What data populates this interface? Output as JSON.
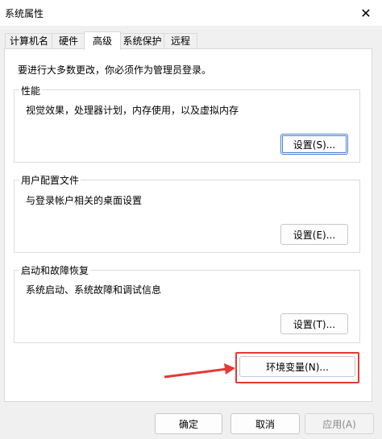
{
  "window": {
    "title": "系统属性",
    "close_icon": "close-icon"
  },
  "tabs": [
    {
      "label": "计算机名",
      "active": false
    },
    {
      "label": "硬件",
      "active": false
    },
    {
      "label": "高级",
      "active": true
    },
    {
      "label": "系统保护",
      "active": false
    },
    {
      "label": "远程",
      "active": false
    }
  ],
  "main": {
    "intro": "要进行大多数更改，你必须作为管理员登录。",
    "performance": {
      "title": "性能",
      "description": "视觉效果，处理器计划，内存使用，以及虚拟内存",
      "button": "设置(S)..."
    },
    "user_profiles": {
      "title": "用户配置文件",
      "description": "与登录帐户相关的桌面设置",
      "button": "设置(E)..."
    },
    "startup_recovery": {
      "title": "启动和故障恢复",
      "description": "系统启动、系统故障和调试信息",
      "button": "设置(T)..."
    },
    "env_button": "环境变量(N)..."
  },
  "footer": {
    "ok": "确定",
    "cancel": "取消",
    "apply": "应用(A)"
  },
  "colors": {
    "annotation": "#e53935",
    "focus": "#4a7fd6"
  }
}
